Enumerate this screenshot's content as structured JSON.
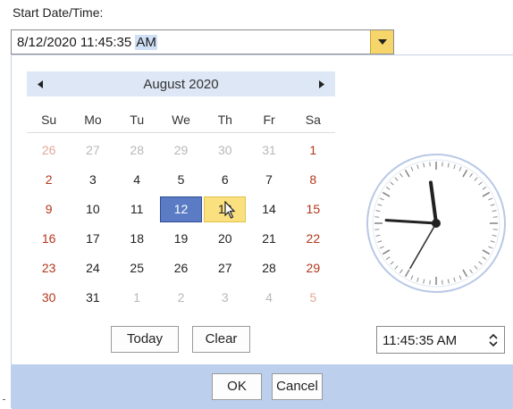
{
  "field": {
    "label": "Start Date/Time:",
    "value_text": "8/12/2020 11:45:35",
    "value_selected": "AM"
  },
  "calendar": {
    "month_title": "August 2020",
    "prev_icon": "triangle-left",
    "next_icon": "triangle-right",
    "weekdays": [
      "Su",
      "Mo",
      "Tu",
      "We",
      "Th",
      "Fr",
      "Sa"
    ],
    "weeks": [
      [
        {
          "d": "26",
          "o": true
        },
        {
          "d": "27",
          "o": true
        },
        {
          "d": "28",
          "o": true
        },
        {
          "d": "29",
          "o": true
        },
        {
          "d": "30",
          "o": true
        },
        {
          "d": "31",
          "o": true
        },
        {
          "d": "1",
          "o": false
        }
      ],
      [
        {
          "d": "2",
          "o": false
        },
        {
          "d": "3",
          "o": false
        },
        {
          "d": "4",
          "o": false
        },
        {
          "d": "5",
          "o": false
        },
        {
          "d": "6",
          "o": false
        },
        {
          "d": "7",
          "o": false
        },
        {
          "d": "8",
          "o": false
        }
      ],
      [
        {
          "d": "9",
          "o": false
        },
        {
          "d": "10",
          "o": false
        },
        {
          "d": "11",
          "o": false
        },
        {
          "d": "12",
          "o": false,
          "state": "selected"
        },
        {
          "d": "13",
          "o": false,
          "state": "hovered"
        },
        {
          "d": "14",
          "o": false
        },
        {
          "d": "15",
          "o": false
        }
      ],
      [
        {
          "d": "16",
          "o": false
        },
        {
          "d": "17",
          "o": false
        },
        {
          "d": "18",
          "o": false
        },
        {
          "d": "19",
          "o": false
        },
        {
          "d": "20",
          "o": false
        },
        {
          "d": "21",
          "o": false
        },
        {
          "d": "22",
          "o": false
        }
      ],
      [
        {
          "d": "23",
          "o": false
        },
        {
          "d": "24",
          "o": false
        },
        {
          "d": "25",
          "o": false
        },
        {
          "d": "26",
          "o": false
        },
        {
          "d": "27",
          "o": false
        },
        {
          "d": "28",
          "o": false
        },
        {
          "d": "29",
          "o": false
        }
      ],
      [
        {
          "d": "30",
          "o": false
        },
        {
          "d": "31",
          "o": false
        },
        {
          "d": "1",
          "o": true
        },
        {
          "d": "2",
          "o": true
        },
        {
          "d": "3",
          "o": true
        },
        {
          "d": "4",
          "o": true
        },
        {
          "d": "5",
          "o": true
        }
      ]
    ],
    "today_label": "Today",
    "clear_label": "Clear"
  },
  "clock": {
    "hour": 11,
    "minute": 45,
    "second": 35
  },
  "time_field": {
    "value": "11:45:35 AM"
  },
  "footer": {
    "ok_label": "OK",
    "cancel_label": "Cancel"
  },
  "colors": {
    "accent_blue": "#5b7cc4",
    "hover_yellow": "#fae07e",
    "weekend_red": "#b3361b",
    "header_blue": "#dde7f6",
    "footer_blue": "#bcd0ee"
  }
}
